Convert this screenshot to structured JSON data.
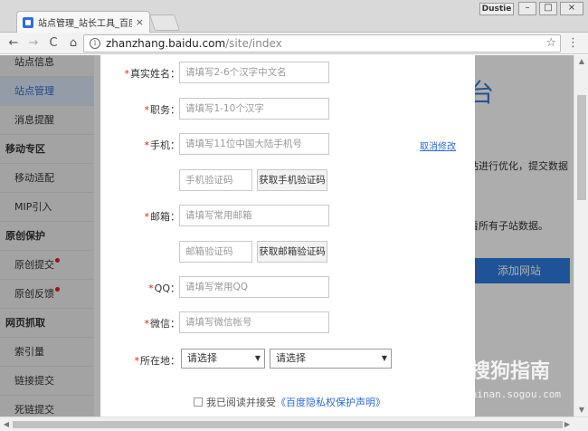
{
  "browser": {
    "tab_title": "站点管理_站长工具_百度",
    "tab_close": "×",
    "user_badge": "Dustie",
    "win_min": "–",
    "win_max": "□",
    "win_close": "×",
    "nav_back": "←",
    "nav_forward": "→",
    "nav_reload": "C",
    "nav_home": "⌂",
    "info_glyph": "i",
    "url_host": "zhanzhang.baidu.com",
    "url_path": "/site/index",
    "star_glyph": "☆",
    "menu_glyph": "⋮"
  },
  "sidebar": {
    "items": [
      {
        "label": "站点信息",
        "type": "item"
      },
      {
        "label": "站点管理",
        "type": "item",
        "active": true
      },
      {
        "label": "消息提醒",
        "type": "item"
      },
      {
        "label": "移动专区",
        "type": "group"
      },
      {
        "label": "移动适配",
        "type": "item"
      },
      {
        "label": "MIP引入",
        "type": "item"
      },
      {
        "label": "原创保护",
        "type": "group"
      },
      {
        "label": "原创提交",
        "type": "item",
        "dot": true
      },
      {
        "label": "原创反馈",
        "type": "item",
        "dot": true
      },
      {
        "label": "网页抓取",
        "type": "group"
      },
      {
        "label": "索引量",
        "type": "item"
      },
      {
        "label": "链接提交",
        "type": "item"
      },
      {
        "label": "死链提交",
        "type": "item"
      }
    ]
  },
  "background": {
    "title_fragment": "台",
    "text1": "站进行优化，提交数据",
    "text2": "看所有子站数据。",
    "add_site_label": "添加网站"
  },
  "form": {
    "name_label": "真实姓名：",
    "name_placeholder": "请填写2-6个汉字中文名",
    "title_label": "职务：",
    "title_placeholder": "请填写1-10个汉字",
    "phone_label": "手机：",
    "phone_placeholder": "请填写11位中国大陆手机号",
    "cancel_edit": "取消修改",
    "phone_code_placeholder": "手机验证码",
    "phone_code_button": "获取手机验证码",
    "email_label": "邮箱：",
    "email_placeholder": "请填写常用邮箱",
    "email_code_placeholder": "邮箱验证码",
    "email_code_button": "获取邮箱验证码",
    "qq_label": "QQ：",
    "qq_placeholder": "请填写常用QQ",
    "wechat_label": "微信：",
    "wechat_placeholder": "请填写微信帐号",
    "location_label": "所在地：",
    "province_select": "请选择",
    "city_select": "请选择",
    "required_mark": "*",
    "agree_text": "我已阅读并接受",
    "policy_link": "《百度隐私权保护声明》"
  },
  "watermark": {
    "text": "搜狗指南",
    "url": "zhinan.sogou.com"
  }
}
